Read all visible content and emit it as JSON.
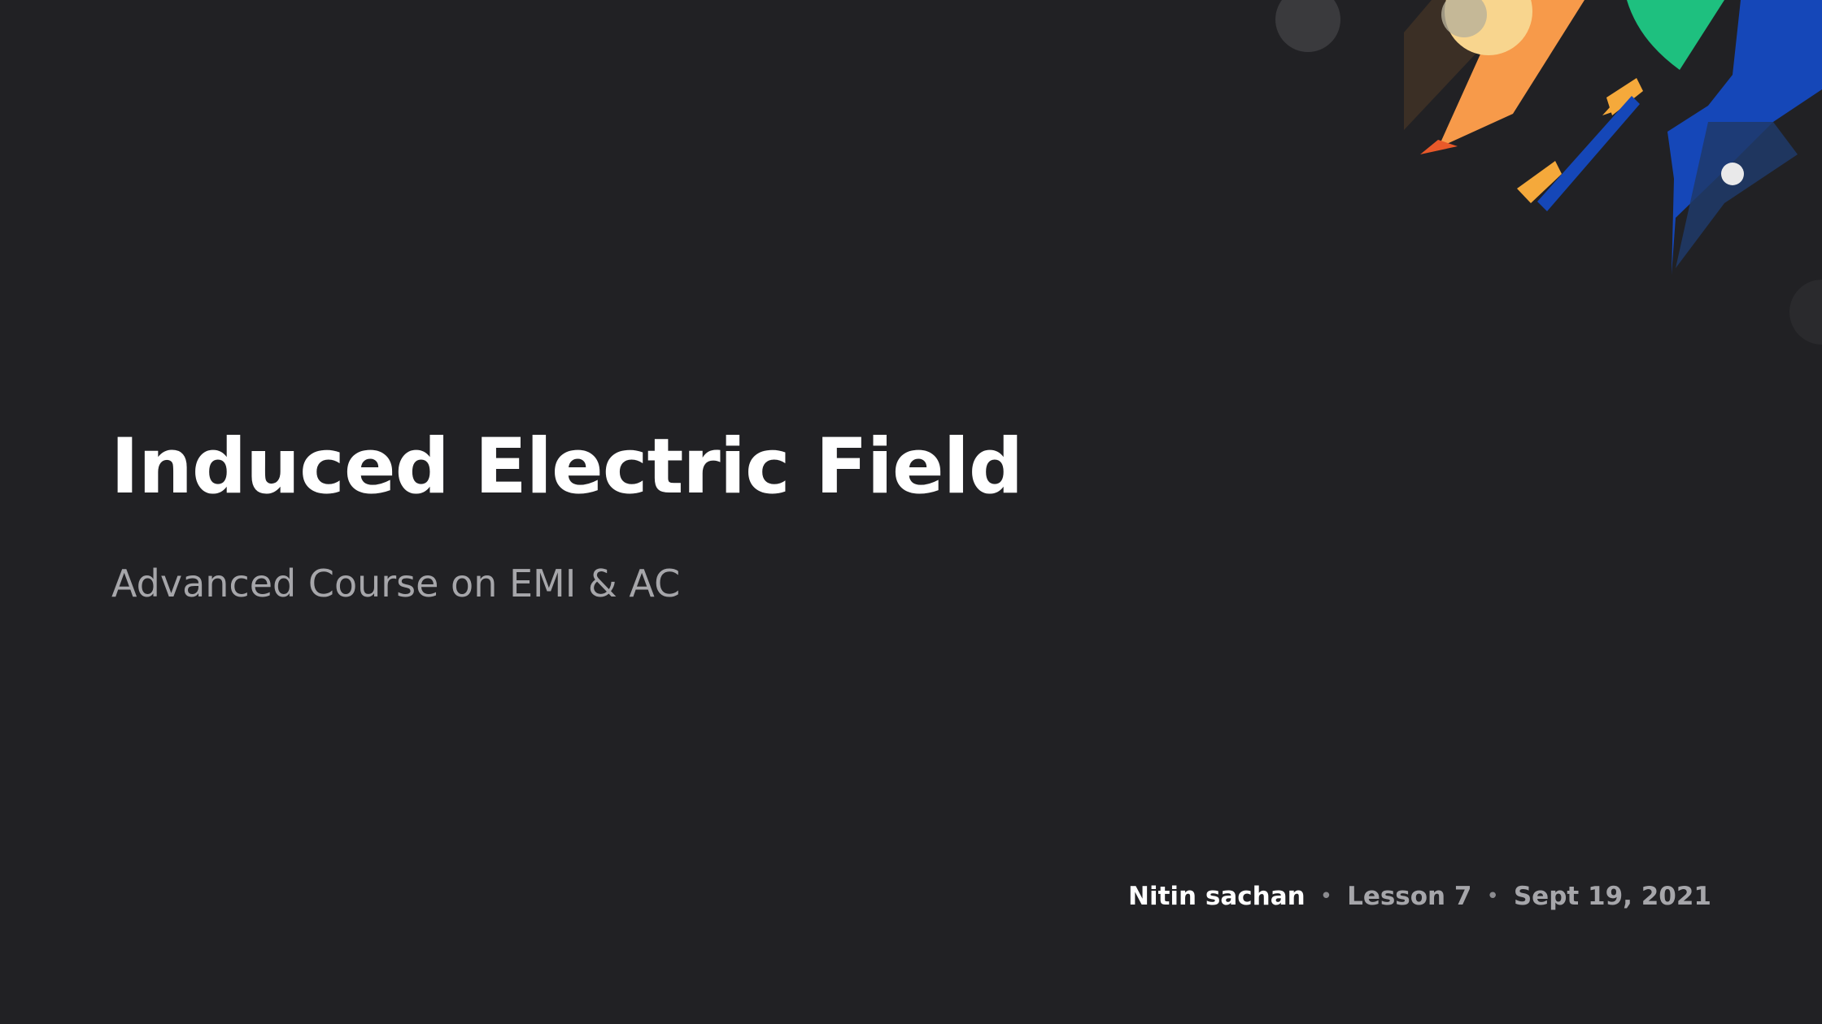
{
  "slide": {
    "title": "Induced Electric Field",
    "subtitle": "Advanced Course on EMI & AC",
    "author": "Nitin sachan",
    "separator": "•",
    "lesson": "Lesson 7",
    "date": "Sept 19, 2021"
  },
  "colors": {
    "background": "#212124",
    "title": "#ffffff",
    "subtitle": "#a6a6aa",
    "accent_orange": "#f79a4a",
    "accent_green": "#1ec07f",
    "accent_blue": "#1547b8",
    "accent_yellow": "#f5a93b"
  }
}
